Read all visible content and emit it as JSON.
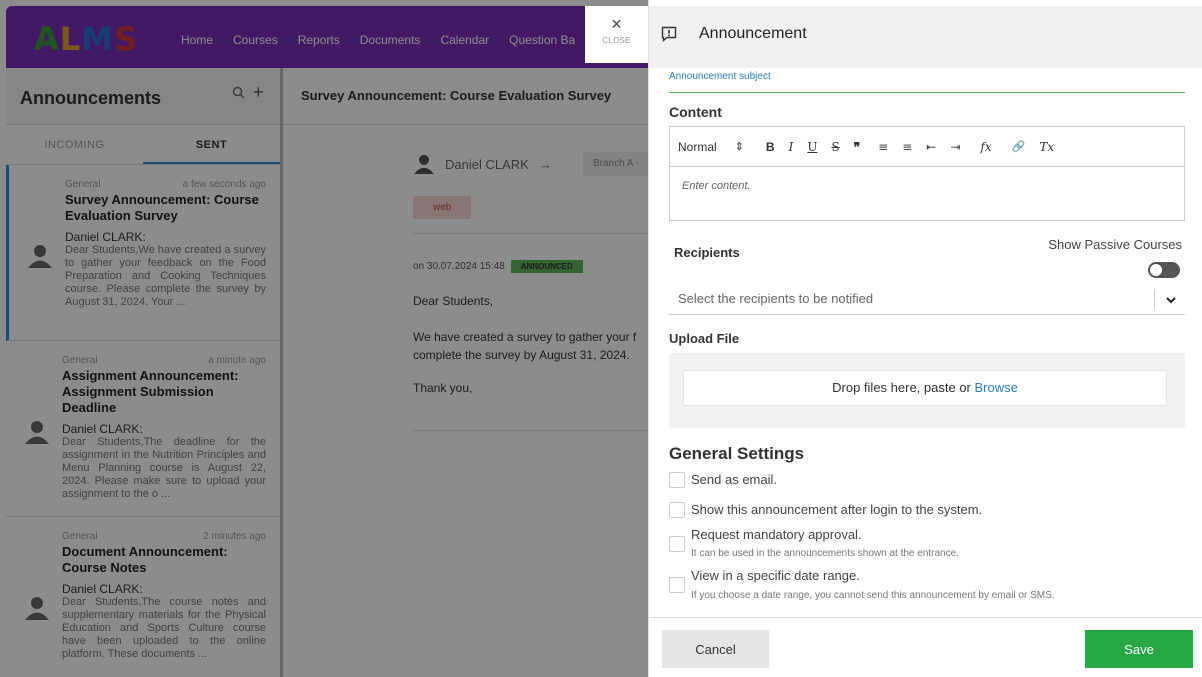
{
  "app": {
    "logo": [
      "A",
      "L",
      "M",
      "S"
    ],
    "nav": [
      "Home",
      "Courses",
      "Reports",
      "Documents",
      "Calendar",
      "Question Ba"
    ]
  },
  "sidebar": {
    "title": "Announcements",
    "tabs": [
      "INCOMING",
      "SENT"
    ],
    "items": [
      {
        "category": "General",
        "time": "a few seconds ago",
        "subject": "Survey Announcement: Course Evaluation Survey",
        "author": "Daniel CLARK:",
        "body": "Dear Students,We have created a survey to gather your feedback on the Food Preparation and Cooking Techniques course. Please complete the survey by August 31, 2024. Your ..."
      },
      {
        "category": "General",
        "time": "a minute ago",
        "subject": "Assignment Announcement: Assignment Submission Deadline",
        "author": "Daniel CLARK:",
        "body": "Dear Students,The deadline for the assignment in the Nutrition Principles and Menu Planning course is August 22, 2024. Please make sure to upload your assignment to the o ..."
      },
      {
        "category": "General",
        "time": "2 minutes ago",
        "subject": "Document Announcement: Course Notes",
        "author": "Daniel CLARK:",
        "body": "Dear Students,The course notes and supplementary materials for the Physical Education and Sports Culture course have been uploaded to the online platform. These documents ..."
      }
    ]
  },
  "detail": {
    "title": "Survey Announcement: Course Evaluation Survey",
    "from": "Daniel CLARK",
    "arrow": "→",
    "branch": "Branch A -",
    "tag": "web",
    "date": "on 30.07.2024 15:48",
    "status": "ANNOUNCED",
    "greeting": "Dear Students,",
    "line1": "We have created a survey to gather your f",
    "line2": "complete the survey by August 31, 2024.",
    "closing": "Thank you,"
  },
  "close": {
    "icon": "×",
    "label": "CLOSE"
  },
  "modal": {
    "title": "Announcement",
    "subject_label": "Announcement subject",
    "content_label": "Content",
    "editor": {
      "format": "Normal",
      "format_arrow": "⇕",
      "tools": [
        "B",
        "I",
        "U",
        "S",
        "❞",
        "≡",
        "≡",
        "⇤",
        "⇥",
        "fx",
        "🔗",
        "Tx"
      ],
      "placeholder": "Enter content."
    },
    "recipients_label": "Recipients",
    "show_passive": "Show Passive Courses",
    "show_passive_on": false,
    "recipients_placeholder": "Select the recipients to be notified",
    "upload_label": "Upload File",
    "drop_text": "Drop files here, paste or",
    "browse": "Browse",
    "general_settings": "General Settings",
    "settings": [
      {
        "label": "Send as email.",
        "hint": ""
      },
      {
        "label": "Show this announcement after login to the system.",
        "hint": ""
      },
      {
        "label": "Request mandatory approval.",
        "hint": "It can be used in the announcements shown at the entrance."
      },
      {
        "label": "View in a specific date range.",
        "hint": "If you choose a date range, you cannot send this announcement by email or SMS."
      }
    ],
    "cancel": "Cancel",
    "save": "Save"
  },
  "colors": {
    "brand": "#7b2fb8",
    "save": "#28a745",
    "link": "#2a7fc4"
  }
}
